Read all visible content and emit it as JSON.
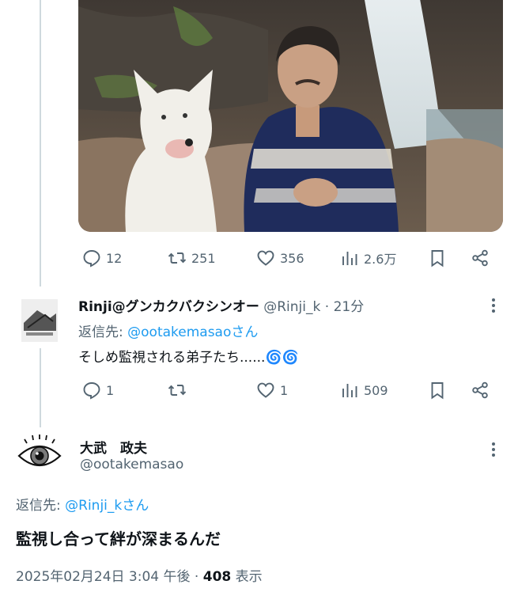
{
  "top_tweet": {
    "actions": {
      "reply_count": "12",
      "retweet_count": "251",
      "like_count": "356",
      "views": "2.6万"
    }
  },
  "reply": {
    "display_name": "Rinji@グンカクバクシンオー",
    "handle": "@Rinji_k",
    "separator": "·",
    "time": "21分",
    "replying_prefix": "返信先: ",
    "replying_to": "@ootakemasaoさん",
    "text": "そしめ監視される弟子たち......",
    "emoji": "🌀🌀",
    "actions": {
      "reply_count": "1",
      "retweet_count": "",
      "like_count": "1",
      "views": "509"
    }
  },
  "main": {
    "display_name": "大武　政夫",
    "handle": "@ootakemasao",
    "replying_prefix": "返信先: ",
    "replying_to": "@Rinji_kさん",
    "text": "監視し合って絆が深まるんだ",
    "meta_time": "2025年02月24日 3:04 午後",
    "meta_sep": " · ",
    "meta_views": "408",
    "meta_views_label": " 表示"
  },
  "colors": {
    "accent": "#1d9bf0",
    "secondary_text": "#536471",
    "thread_line": "#cfd9de"
  },
  "icons": [
    "reply-icon",
    "retweet-icon",
    "like-icon",
    "views-icon",
    "bookmark-icon",
    "share-icon",
    "more-icon",
    "eye-avatar-icon"
  ]
}
